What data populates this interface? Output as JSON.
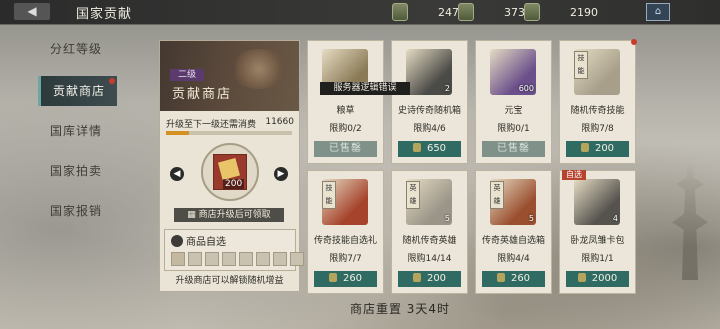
{
  "header": {
    "title": "国家贡献",
    "back_icon": "back-arrow-icon"
  },
  "resources": [
    {
      "icon": "scroll-icon",
      "value": "2470"
    },
    {
      "icon": "token-icon",
      "value": "3734"
    },
    {
      "icon": "coin-icon",
      "value": "2190"
    }
  ],
  "sidebar": {
    "items": [
      {
        "label": "分红等级"
      },
      {
        "label": "贡献商店"
      },
      {
        "label": "国库详情"
      },
      {
        "label": "国家拍卖"
      },
      {
        "label": "国家报销"
      }
    ]
  },
  "shop": {
    "level_tag": "二级",
    "name": "贡献商店",
    "upgrade_label": "升级至下一级还需消费",
    "upgrade_value": "11660",
    "progress": 0.18,
    "card_count": "200",
    "unlock_button": "商店升级后可领取",
    "select_title": "商品自选",
    "unlock_note": "升级商店可以解锁随机增益"
  },
  "error_message": "服务器逻辑错误",
  "items": [
    {
      "name": "粮草",
      "limit": "限购0/2",
      "price": "已售罄",
      "sold": true,
      "qty": "",
      "tag": "",
      "sale": "",
      "thumb": "#8a7a55"
    },
    {
      "name": "史诗传奇随机箱",
      "limit": "限购4/6",
      "price": "650",
      "sold": false,
      "qty": "2",
      "tag": "",
      "sale": "",
      "thumb": "#4a4a46"
    },
    {
      "name": "元宝",
      "limit": "限购0/1",
      "price": "已售罄",
      "sold": true,
      "qty": "600",
      "tag": "",
      "sale": "",
      "thumb": "#6a4f8a"
    },
    {
      "name": "随机传奇技能",
      "limit": "限购7/8",
      "price": "200",
      "sold": false,
      "qty": "",
      "tag": "技能",
      "sale": "",
      "thumb": "#a79f8a"
    },
    {
      "name": "传奇技能自选礼",
      "limit": "限购7/7",
      "price": "260",
      "sold": false,
      "qty": "",
      "tag": "技能",
      "sale": "",
      "thumb": "#a5432c"
    },
    {
      "name": "随机传奇英雄",
      "limit": "限购14/14",
      "price": "200",
      "sold": false,
      "qty": "5",
      "tag": "英雄",
      "sale": "",
      "thumb": "#9a9588"
    },
    {
      "name": "传奇英雄自选箱",
      "limit": "限购4/4",
      "price": "260",
      "sold": false,
      "qty": "5",
      "tag": "英雄",
      "sale": "",
      "thumb": "#9a4f2f"
    },
    {
      "name": "卧龙凤雏卡包",
      "limit": "限购1/1",
      "price": "2000",
      "sold": false,
      "qty": "4",
      "tag": "",
      "sale": "自选",
      "thumb": "#56534e"
    }
  ],
  "footer": {
    "reset_text": "商店重置 3天4时"
  }
}
